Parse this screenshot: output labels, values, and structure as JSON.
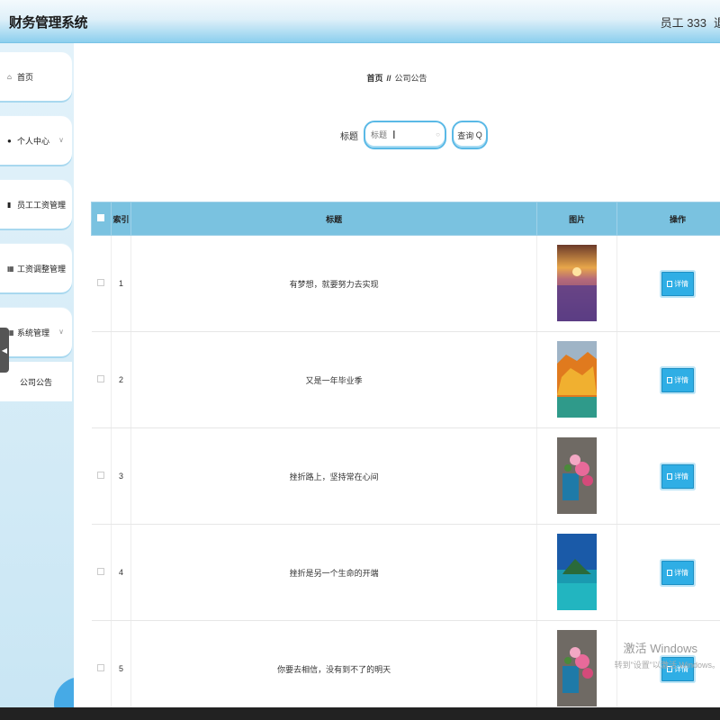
{
  "header": {
    "app_title": "财务管理系统",
    "user_label": "员工 333",
    "logout_label": "退"
  },
  "sidebar": {
    "items": [
      {
        "label": "首页",
        "icon": "home-icon"
      },
      {
        "label": "个人中心",
        "icon": "user-icon"
      },
      {
        "label": "员工工资管理",
        "icon": "phone-icon"
      },
      {
        "label": "工资调整管理",
        "icon": "grid-icon"
      },
      {
        "label": "系统管理",
        "icon": "grid-icon"
      }
    ],
    "sub_item": "公司公告"
  },
  "breadcrumb": {
    "home": "首页",
    "separator": "//",
    "current": "公司公告"
  },
  "search": {
    "label": "标题",
    "placeholder": "标题",
    "button": "查询"
  },
  "table": {
    "headers": {
      "index": "索引",
      "title": "标题",
      "image": "图片",
      "action": "操作"
    },
    "detail_label": "详情",
    "rows": [
      {
        "index": "1",
        "title": "有梦想，就要努力去实现",
        "image": "lavender-sunset"
      },
      {
        "index": "2",
        "title": "又是一年毕业季",
        "image": "autumn-lake"
      },
      {
        "index": "3",
        "title": "挫折路上，坚持常在心间",
        "image": "flower-bucket"
      },
      {
        "index": "4",
        "title": "挫折是另一个生命的开端",
        "image": "tropical-island"
      },
      {
        "index": "5",
        "title": "你要去相信，没有到不了的明天",
        "image": "flower-bucket"
      }
    ]
  },
  "watermark": {
    "line1": "激活 Windows",
    "line2": "转到\"设置\"以激活 Windows。"
  },
  "colors": {
    "header_accent": "#8ccfee",
    "table_header": "#7ac2e0",
    "button": "#2faee5"
  }
}
